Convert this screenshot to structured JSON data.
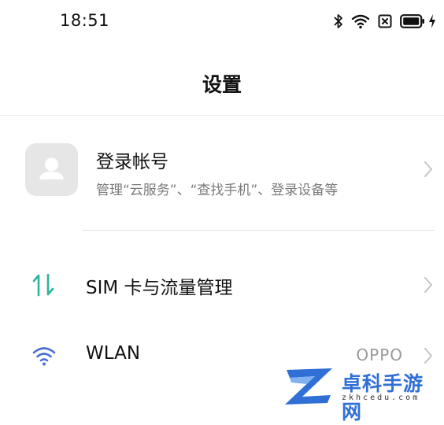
{
  "status_bar": {
    "time": "18:51",
    "icons": [
      "bluetooth-icon",
      "wifi-icon",
      "no-sim-icon",
      "battery-icon",
      "charging-icon"
    ]
  },
  "header": {
    "title": "设置"
  },
  "account": {
    "title": "登录帐号",
    "subtitle": "管理“云服务”、“查找手机”、登录设备等",
    "avatar_icon": "person-placeholder-icon"
  },
  "rows": [
    {
      "label": "SIM 卡与流量管理",
      "icon": "sim-data-transfer-icon",
      "icon_color": "#2bb39b"
    },
    {
      "label": "WLAN",
      "value": "OPPO",
      "icon": "wifi-icon",
      "icon_color": "#4a6fd4"
    }
  ],
  "watermark": {
    "title": "卓科手游网",
    "domain": "zkhcedu.com"
  },
  "colors": {
    "background": "#ffffff",
    "text_primary": "#111111",
    "text_secondary": "#7a7a7a",
    "chevron": "#c4c4c4",
    "watermark": "#2f6fd6"
  }
}
